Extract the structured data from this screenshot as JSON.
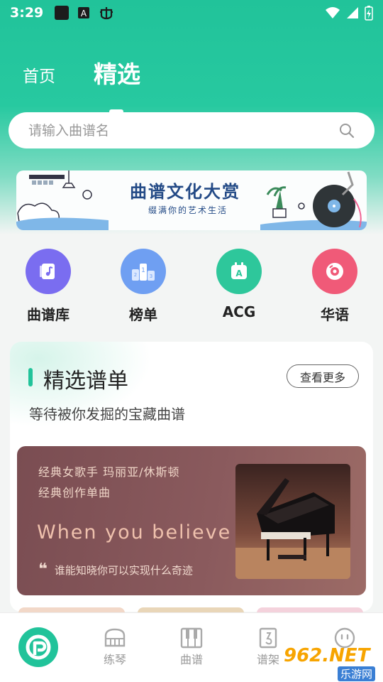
{
  "status_bar": {
    "time": "3:29"
  },
  "top_tabs": {
    "home": "首页",
    "featured": "精选"
  },
  "search": {
    "placeholder": "请输入曲谱名"
  },
  "banner": {
    "title": "曲谱文化大赏",
    "subtitle": "缀满你的艺术生活"
  },
  "categories": [
    {
      "label": "曲谱库",
      "icon": "music-note-icon",
      "color": "#7a6df0"
    },
    {
      "label": "榜单",
      "icon": "podium-icon",
      "color": "#6f9ff2"
    },
    {
      "label": "ACG",
      "icon": "calendar-a-icon",
      "color": "#2ec79b"
    },
    {
      "label": "华语",
      "icon": "vinyl-disc-icon",
      "color": "#f05a78"
    }
  ],
  "playlist_card": {
    "title": "精选谱单",
    "more_label": "查看更多",
    "subtitle": "等待被你发掘的宝藏曲谱",
    "feature": {
      "line1": "经典女歌手 玛丽亚/休斯顿",
      "line2": "经典创作单曲",
      "song": "When you believe",
      "quote": "谁能知晓你可以实现什么奇迹"
    }
  },
  "bottom_nav": {
    "items": [
      {
        "label": "练琴",
        "icon": "piano-icon"
      },
      {
        "label": "曲谱",
        "icon": "keyboard-icon"
      },
      {
        "label": "谱架",
        "icon": "music-stand-icon"
      }
    ]
  },
  "watermark": {
    "text": "962.NET",
    "sub": "乐游网"
  },
  "colors": {
    "accent": "#21c39a",
    "feature_bg": "#7a4d52",
    "feature_text": "#efc1ad"
  }
}
